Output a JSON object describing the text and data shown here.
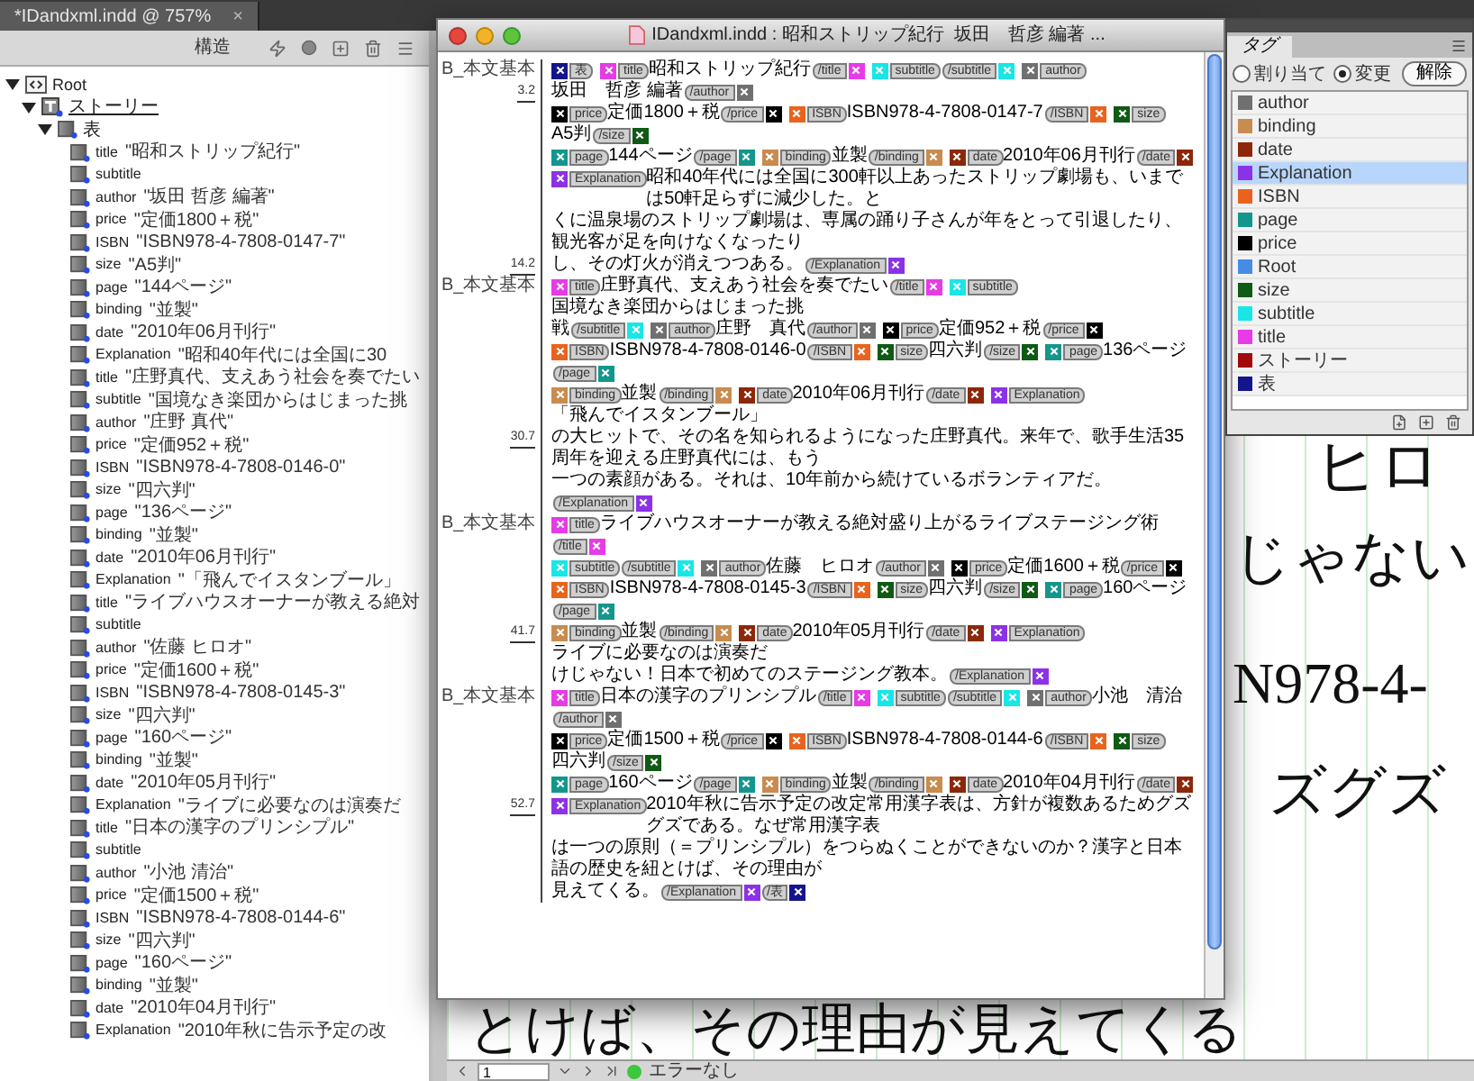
{
  "document_tab": {
    "title": "*IDandxml.indd @ 757%",
    "close": "×"
  },
  "structure_panel": {
    "title": "構造",
    "tree": [
      {
        "kind": "root",
        "label": "Root",
        "expanded": true,
        "children": [
          {
            "kind": "story",
            "label": "ストーリー",
            "expanded": true,
            "children": [
              {
                "kind": "table",
                "label": "表",
                "expanded": true,
                "children": [
                  {
                    "kind": "element",
                    "label": "title",
                    "value": "\"昭和ストリップ紀行\""
                  },
                  {
                    "kind": "element",
                    "label": "subtitle"
                  },
                  {
                    "kind": "element",
                    "label": "author",
                    "value": "\"坂田 哲彦 編著\""
                  },
                  {
                    "kind": "element",
                    "label": "price",
                    "value": "\"定価1800＋税\""
                  },
                  {
                    "kind": "element",
                    "label": "ISBN",
                    "value": "\"ISBN978-4-7808-0147-7\""
                  },
                  {
                    "kind": "element",
                    "label": "size",
                    "value": "\"A5判\""
                  },
                  {
                    "kind": "element",
                    "label": "page",
                    "value": "\"144ページ\""
                  },
                  {
                    "kind": "element",
                    "label": "binding",
                    "value": "\"並製\""
                  },
                  {
                    "kind": "element",
                    "label": "date",
                    "value": "\"2010年06月刊行\""
                  },
                  {
                    "kind": "element",
                    "label": "Explanation",
                    "value": "\"昭和40年代には全国に30"
                  },
                  {
                    "kind": "element",
                    "label": "title",
                    "value": "\"庄野真代、支えあう社会を奏でたい"
                  },
                  {
                    "kind": "element",
                    "label": "subtitle",
                    "value": "\"国境なき楽団からはじまった挑"
                  },
                  {
                    "kind": "element",
                    "label": "author",
                    "value": "\"庄野 真代\""
                  },
                  {
                    "kind": "element",
                    "label": "price",
                    "value": "\"定価952＋税\""
                  },
                  {
                    "kind": "element",
                    "label": "ISBN",
                    "value": "\"ISBN978-4-7808-0146-0\""
                  },
                  {
                    "kind": "element",
                    "label": "size",
                    "value": "\"四六判\""
                  },
                  {
                    "kind": "element",
                    "label": "page",
                    "value": "\"136ページ\""
                  },
                  {
                    "kind": "element",
                    "label": "binding",
                    "value": "\"並製\""
                  },
                  {
                    "kind": "element",
                    "label": "date",
                    "value": "\"2010年06月刊行\""
                  },
                  {
                    "kind": "element",
                    "label": "Explanation",
                    "value": "\"「飛んでイスタンブール」"
                  },
                  {
                    "kind": "element",
                    "label": "title",
                    "value": "\"ライブハウスオーナーが教える絶対"
                  },
                  {
                    "kind": "element",
                    "label": "subtitle"
                  },
                  {
                    "kind": "element",
                    "label": "author",
                    "value": "\"佐藤 ヒロオ\""
                  },
                  {
                    "kind": "element",
                    "label": "price",
                    "value": "\"定価1600＋税\""
                  },
                  {
                    "kind": "element",
                    "label": "ISBN",
                    "value": "\"ISBN978-4-7808-0145-3\""
                  },
                  {
                    "kind": "element",
                    "label": "size",
                    "value": "\"四六判\""
                  },
                  {
                    "kind": "element",
                    "label": "page",
                    "value": "\"160ページ\""
                  },
                  {
                    "kind": "element",
                    "label": "binding",
                    "value": "\"並製\""
                  },
                  {
                    "kind": "element",
                    "label": "date",
                    "value": "\"2010年05月刊行\""
                  },
                  {
                    "kind": "element",
                    "label": "Explanation",
                    "value": "\"ライブに必要なのは演奏だ"
                  },
                  {
                    "kind": "element",
                    "label": "title",
                    "value": "\"日本の漢字のプリンシプル\""
                  },
                  {
                    "kind": "element",
                    "label": "subtitle"
                  },
                  {
                    "kind": "element",
                    "label": "author",
                    "value": "\"小池 清治\""
                  },
                  {
                    "kind": "element",
                    "label": "price",
                    "value": "\"定価1500＋税\""
                  },
                  {
                    "kind": "element",
                    "label": "ISBN",
                    "value": "\"ISBN978-4-7808-0144-6\""
                  },
                  {
                    "kind": "element",
                    "label": "size",
                    "value": "\"四六判\""
                  },
                  {
                    "kind": "element",
                    "label": "page",
                    "value": "\"160ページ\""
                  },
                  {
                    "kind": "element",
                    "label": "binding",
                    "value": "\"並製\""
                  },
                  {
                    "kind": "element",
                    "label": "date",
                    "value": "\"2010年04月刊行\""
                  },
                  {
                    "kind": "element",
                    "label": "Explanation",
                    "value": "\"2010年秋に告示予定の改"
                  }
                ]
              }
            ]
          }
        ]
      }
    ]
  },
  "story_editor": {
    "title": "IDandxml.indd : 昭和ストリップ紀行  坂田　哲彦 編著 ...",
    "lines": [
      {
        "style": "B_本文基本",
        "depth": "3.2",
        "tokens": [
          {
            "kind": "open",
            "tag": "表",
            "color": "#14148c"
          },
          {
            "kind": "open",
            "tag": "title",
            "color": "#e63be6"
          },
          {
            "kind": "text",
            "text": "昭和ストリップ紀行"
          },
          {
            "kind": "close",
            "tag": "/title",
            "color": "#e63be6"
          },
          {
            "kind": "open",
            "tag": "subtitle",
            "color": "#19e6e6"
          },
          {
            "kind": "close",
            "tag": "/subtitle",
            "color": "#19e6e6"
          },
          {
            "kind": "open",
            "tag": "author",
            "color": "#707070"
          },
          {
            "kind": "text",
            "text": "坂田　哲彦 編著"
          },
          {
            "kind": "close",
            "tag": "/author",
            "color": "#707070"
          }
        ]
      },
      {
        "tokens": [
          {
            "kind": "open",
            "tag": "price",
            "color": "#000000"
          },
          {
            "kind": "text",
            "text": "定価1800＋税"
          },
          {
            "kind": "close",
            "tag": "/price",
            "color": "#000000"
          },
          {
            "kind": "open",
            "tag": "ISBN",
            "color": "#e8641e"
          },
          {
            "kind": "text",
            "text": "ISBN978-4-7808-0147-7"
          },
          {
            "kind": "close",
            "tag": "/ISBN",
            "color": "#e8641e"
          },
          {
            "kind": "open",
            "tag": "size",
            "color": "#0f5a14"
          },
          {
            "kind": "text",
            "text": "A5判"
          },
          {
            "kind": "close",
            "tag": "/size",
            "color": "#0f5a14"
          }
        ]
      },
      {
        "tokens": [
          {
            "kind": "open",
            "tag": "page",
            "color": "#14968c"
          },
          {
            "kind": "text",
            "text": "144ページ"
          },
          {
            "kind": "close",
            "tag": "/page",
            "color": "#14968c"
          },
          {
            "kind": "open",
            "tag": "binding",
            "color": "#c88c50"
          },
          {
            "kind": "text",
            "text": "並製"
          },
          {
            "kind": "close",
            "tag": "/binding",
            "color": "#c88c50"
          },
          {
            "kind": "open",
            "tag": "date",
            "color": "#8c280a"
          },
          {
            "kind": "text",
            "text": "2010年06月刊行"
          },
          {
            "kind": "close",
            "tag": "/date",
            "color": "#8c280a"
          }
        ]
      },
      {
        "tokens": [
          {
            "kind": "open",
            "tag": "Explanation",
            "color": "#8c32e6"
          },
          {
            "kind": "text",
            "text": "昭和40年代には全国に300軒以上あったストリップ劇場も、いまでは50軒足らずに減少した。と"
          }
        ]
      },
      {
        "tokens": [
          {
            "kind": "text",
            "text": "くに温泉場のストリップ劇場は、専属の踊り子さんが年をとって引退したり、観光客が足を向けなくなったり"
          }
        ]
      },
      {
        "depth": "14.2",
        "tokens": [
          {
            "kind": "text",
            "text": "し、その灯火が消えつつある。"
          },
          {
            "kind": "close",
            "tag": "/Explanation",
            "color": "#8c32e6"
          }
        ]
      },
      {
        "style": "B_本文基本",
        "tokens": [
          {
            "kind": "open",
            "tag": "title",
            "color": "#e63be6"
          },
          {
            "kind": "text",
            "text": "庄野真代、支えあう社会を奏でたい"
          },
          {
            "kind": "close",
            "tag": "/title",
            "color": "#e63be6"
          },
          {
            "kind": "open",
            "tag": "subtitle",
            "color": "#19e6e6"
          },
          {
            "kind": "text",
            "text": "国境なき楽団からはじまった挑"
          }
        ]
      },
      {
        "tokens": [
          {
            "kind": "text",
            "text": "戦"
          },
          {
            "kind": "close",
            "tag": "/subtitle",
            "color": "#19e6e6"
          },
          {
            "kind": "open",
            "tag": "author",
            "color": "#707070"
          },
          {
            "kind": "text",
            "text": "庄野　真代"
          },
          {
            "kind": "close",
            "tag": "/author",
            "color": "#707070"
          },
          {
            "kind": "open",
            "tag": "price",
            "color": "#000000"
          },
          {
            "kind": "text",
            "text": "定価952＋税"
          },
          {
            "kind": "close",
            "tag": "/price",
            "color": "#000000"
          }
        ]
      },
      {
        "tokens": [
          {
            "kind": "open",
            "tag": "ISBN",
            "color": "#e8641e"
          },
          {
            "kind": "text",
            "text": "ISBN978-4-7808-0146-0"
          },
          {
            "kind": "close",
            "tag": "/ISBN",
            "color": "#e8641e"
          },
          {
            "kind": "open",
            "tag": "size",
            "color": "#0f5a14"
          },
          {
            "kind": "text",
            "text": "四六判"
          },
          {
            "kind": "close",
            "tag": "/size",
            "color": "#0f5a14"
          },
          {
            "kind": "open",
            "tag": "page",
            "color": "#14968c"
          },
          {
            "kind": "text",
            "text": "136ページ"
          },
          {
            "kind": "close",
            "tag": "/page",
            "color": "#14968c"
          }
        ]
      },
      {
        "tokens": [
          {
            "kind": "open",
            "tag": "binding",
            "color": "#c88c50"
          },
          {
            "kind": "text",
            "text": "並製"
          },
          {
            "kind": "close",
            "tag": "/binding",
            "color": "#c88c50"
          },
          {
            "kind": "open",
            "tag": "date",
            "color": "#8c280a"
          },
          {
            "kind": "text",
            "text": "2010年06月刊行"
          },
          {
            "kind": "close",
            "tag": "/date",
            "color": "#8c280a"
          },
          {
            "kind": "open",
            "tag": "Explanation",
            "color": "#8c32e6"
          },
          {
            "kind": "text",
            "text": "「飛んでイスタンブール」"
          }
        ]
      },
      {
        "depth": "30.7",
        "tokens": [
          {
            "kind": "text",
            "text": "の大ヒットで、その名を知られるようになった庄野真代。来年で、歌手生活35周年を迎える庄野真代には、もう"
          }
        ]
      },
      {
        "tokens": [
          {
            "kind": "text",
            "text": "一つの素顔がある。それは、10年前から続けているボランティアだ。"
          },
          {
            "kind": "close",
            "tag": "/Explanation",
            "color": "#8c32e6"
          }
        ]
      },
      {
        "style": "B_本文基本",
        "tokens": [
          {
            "kind": "open",
            "tag": "title",
            "color": "#e63be6"
          },
          {
            "kind": "text",
            "text": "ライブハウスオーナーが教える絶対盛り上がるライブステージング術"
          },
          {
            "kind": "close",
            "tag": "/title",
            "color": "#e63be6"
          }
        ]
      },
      {
        "tokens": [
          {
            "kind": "open",
            "tag": "subtitle",
            "color": "#19e6e6"
          },
          {
            "kind": "close",
            "tag": "/subtitle",
            "color": "#19e6e6"
          },
          {
            "kind": "open",
            "tag": "author",
            "color": "#707070"
          },
          {
            "kind": "text",
            "text": "佐藤　ヒロオ"
          },
          {
            "kind": "close",
            "tag": "/author",
            "color": "#707070"
          },
          {
            "kind": "open",
            "tag": "price",
            "color": "#000000"
          },
          {
            "kind": "text",
            "text": "定価1600＋税"
          },
          {
            "kind": "close",
            "tag": "/price",
            "color": "#000000"
          }
        ]
      },
      {
        "tokens": [
          {
            "kind": "open",
            "tag": "ISBN",
            "color": "#e8641e"
          },
          {
            "kind": "text",
            "text": "ISBN978-4-7808-0145-3"
          },
          {
            "kind": "close",
            "tag": "/ISBN",
            "color": "#e8641e"
          },
          {
            "kind": "open",
            "tag": "size",
            "color": "#0f5a14"
          },
          {
            "kind": "text",
            "text": "四六判"
          },
          {
            "kind": "close",
            "tag": "/size",
            "color": "#0f5a14"
          },
          {
            "kind": "open",
            "tag": "page",
            "color": "#14968c"
          },
          {
            "kind": "text",
            "text": "160ページ"
          },
          {
            "kind": "close",
            "tag": "/page",
            "color": "#14968c"
          }
        ]
      },
      {
        "depth": "41.7",
        "tokens": [
          {
            "kind": "open",
            "tag": "binding",
            "color": "#c88c50"
          },
          {
            "kind": "text",
            "text": "並製"
          },
          {
            "kind": "close",
            "tag": "/binding",
            "color": "#c88c50"
          },
          {
            "kind": "open",
            "tag": "date",
            "color": "#8c280a"
          },
          {
            "kind": "text",
            "text": "2010年05月刊行"
          },
          {
            "kind": "close",
            "tag": "/date",
            "color": "#8c280a"
          },
          {
            "kind": "open",
            "tag": "Explanation",
            "color": "#8c32e6"
          },
          {
            "kind": "text",
            "text": "ライブに必要なのは演奏だ"
          }
        ]
      },
      {
        "tokens": [
          {
            "kind": "text",
            "text": "けじゃない！日本で初めてのステージング教本。"
          },
          {
            "kind": "close",
            "tag": "/Explanation",
            "color": "#8c32e6"
          }
        ]
      },
      {
        "style": "B_本文基本",
        "tokens": [
          {
            "kind": "open",
            "tag": "title",
            "color": "#e63be6"
          },
          {
            "kind": "text",
            "text": "日本の漢字のプリンシプル"
          },
          {
            "kind": "close",
            "tag": "/title",
            "color": "#e63be6"
          },
          {
            "kind": "open",
            "tag": "subtitle",
            "color": "#19e6e6"
          },
          {
            "kind": "close",
            "tag": "/subtitle",
            "color": "#19e6e6"
          },
          {
            "kind": "open",
            "tag": "author",
            "color": "#707070"
          },
          {
            "kind": "text",
            "text": "小池　清治"
          },
          {
            "kind": "close",
            "tag": "/author",
            "color": "#707070"
          }
        ]
      },
      {
        "tokens": [
          {
            "kind": "open",
            "tag": "price",
            "color": "#000000"
          },
          {
            "kind": "text",
            "text": "定価1500＋税"
          },
          {
            "kind": "close",
            "tag": "/price",
            "color": "#000000"
          },
          {
            "kind": "open",
            "tag": "ISBN",
            "color": "#e8641e"
          },
          {
            "kind": "text",
            "text": "ISBN978-4-7808-0144-6"
          },
          {
            "kind": "close",
            "tag": "/ISBN",
            "color": "#e8641e"
          },
          {
            "kind": "open",
            "tag": "size",
            "color": "#0f5a14"
          },
          {
            "kind": "text",
            "text": "四六判"
          },
          {
            "kind": "close",
            "tag": "/size",
            "color": "#0f5a14"
          }
        ]
      },
      {
        "tokens": [
          {
            "kind": "open",
            "tag": "page",
            "color": "#14968c"
          },
          {
            "kind": "text",
            "text": "160ページ"
          },
          {
            "kind": "close",
            "tag": "/page",
            "color": "#14968c"
          },
          {
            "kind": "open",
            "tag": "binding",
            "color": "#c88c50"
          },
          {
            "kind": "text",
            "text": "並製"
          },
          {
            "kind": "close",
            "tag": "/binding",
            "color": "#c88c50"
          },
          {
            "kind": "open",
            "tag": "date",
            "color": "#8c280a"
          },
          {
            "kind": "text",
            "text": "2010年04月刊行"
          },
          {
            "kind": "close",
            "tag": "/date",
            "color": "#8c280a"
          }
        ]
      },
      {
        "depth": "52.7",
        "tokens": [
          {
            "kind": "open",
            "tag": "Explanation",
            "color": "#8c32e6"
          },
          {
            "kind": "text",
            "text": "2010年秋に告示予定の改定常用漢字表は、方針が複数あるためグズグズである。なぜ常用漢字表"
          }
        ]
      },
      {
        "tokens": [
          {
            "kind": "text",
            "text": "は一つの原則（＝プリンシプル）をつらぬくことができないのか？漢字と日本語の歴史を紐とけば、その理由が"
          }
        ]
      },
      {
        "tokens": [
          {
            "kind": "text",
            "text": "見えてくる。"
          },
          {
            "kind": "close",
            "tag": "/Explanation",
            "color": "#8c32e6"
          },
          {
            "kind": "close",
            "tag": "/表",
            "color": "#14148c"
          }
        ]
      }
    ]
  },
  "tags_panel": {
    "title": "タグ",
    "modes": [
      {
        "label": "割り当て",
        "selected": false
      },
      {
        "label": "変更",
        "selected": true
      }
    ],
    "button": "解除",
    "tags": [
      {
        "name": "author",
        "color": "#707070",
        "selected": false
      },
      {
        "name": "binding",
        "color": "#c88c50",
        "selected": false
      },
      {
        "name": "date",
        "color": "#8c280a",
        "selected": false
      },
      {
        "name": "Explanation",
        "color": "#8c32e6",
        "selected": true
      },
      {
        "name": "ISBN",
        "color": "#e8641e",
        "selected": false
      },
      {
        "name": "page",
        "color": "#14968c",
        "selected": false
      },
      {
        "name": "price",
        "color": "#000000",
        "selected": false
      },
      {
        "name": "Root",
        "color": "#468ce6",
        "selected": false
      },
      {
        "name": "size",
        "color": "#0f5a14",
        "selected": false
      },
      {
        "name": "subtitle",
        "color": "#19e6e6",
        "selected": false
      },
      {
        "name": "title",
        "color": "#e63be6",
        "selected": false
      },
      {
        "name": "ストーリー",
        "color": "#a00a0a",
        "selected": false
      },
      {
        "name": "表",
        "color": "#14148c",
        "selected": false
      }
    ]
  },
  "canvas_text": [
    {
      "text": "ヒロ"
    },
    {
      "text": "じゃない"
    },
    {
      "text": "N978-4-"
    },
    {
      "text": "ズグズ"
    },
    {
      "text": "とけば、その理由が見えてくる"
    }
  ],
  "status_bar": {
    "page": "1",
    "preflight": "エラーなし"
  }
}
